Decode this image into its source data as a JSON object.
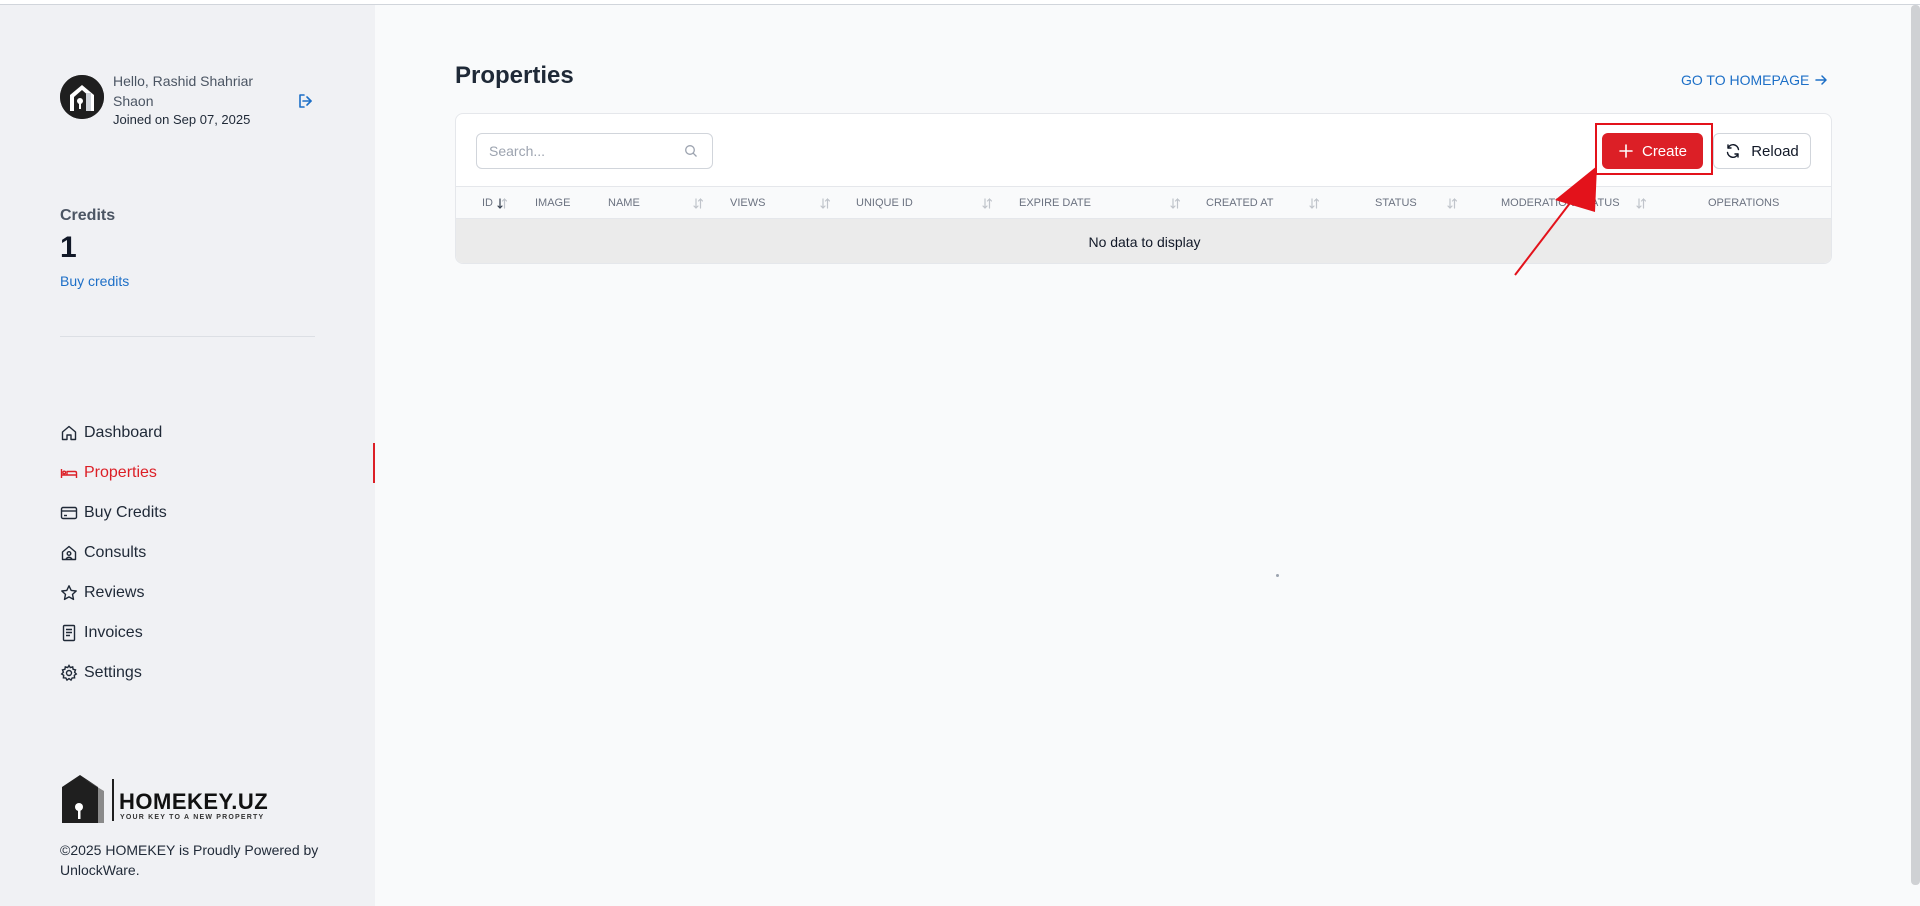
{
  "user": {
    "greeting": "Hello, Rashid Shahriar Shaon",
    "joined": "Joined on Sep 07, 2025"
  },
  "credits": {
    "label": "Credits",
    "value": "1",
    "buy_link": "Buy credits"
  },
  "nav": {
    "items": [
      {
        "label": "Dashboard",
        "icon": "home-icon"
      },
      {
        "label": "Properties",
        "icon": "bed-icon",
        "active": true
      },
      {
        "label": "Buy Credits",
        "icon": "credit-card-icon"
      },
      {
        "label": "Consults",
        "icon": "house-user-icon"
      },
      {
        "label": "Reviews",
        "icon": "star-icon"
      },
      {
        "label": "Invoices",
        "icon": "receipt-icon"
      },
      {
        "label": "Settings",
        "icon": "gear-icon"
      }
    ]
  },
  "brand": {
    "name": "HOMEKEY.UZ",
    "tagline": "YOUR KEY TO A NEW PROPERTY",
    "copyright": "©2025 HOMEKEY is Proudly Powered by UnlockWare."
  },
  "main": {
    "title": "Properties",
    "homepage_link": "GO TO HOMEPAGE",
    "search_placeholder": "Search...",
    "create_label": "Create",
    "reload_label": "Reload",
    "columns": [
      "ID",
      "IMAGE",
      "NAME",
      "VIEWS",
      "UNIQUE ID",
      "EXPIRE DATE",
      "CREATED AT",
      "STATUS",
      "MODERATION STATUS",
      "OPERATIONS"
    ],
    "empty_text": "No data to display"
  },
  "colors": {
    "accent": "#dc1f26",
    "link": "#1d6fc7",
    "sidebar_bg": "#f0f1f4"
  }
}
